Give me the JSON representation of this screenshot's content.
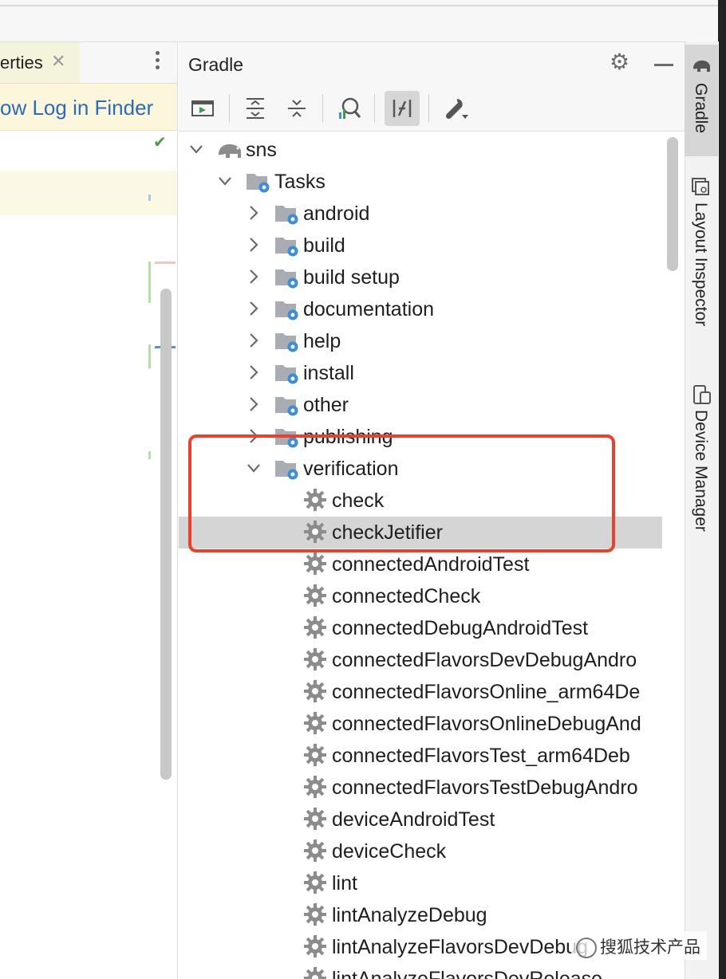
{
  "editor": {
    "tab_label": "erties",
    "close_glyph": "✕",
    "notification_link": "ow Log in Finder"
  },
  "gradle": {
    "title": "Gradle",
    "toolbar": {
      "icons": [
        "run-task-icon",
        "expand-all-icon",
        "collapse-all-icon",
        "analyze-dependencies-icon",
        "toggle-offline-icon",
        "build-settings-icon"
      ]
    },
    "tree": {
      "root": "sns",
      "tasks_label": "Tasks",
      "groups": [
        "android",
        "build",
        "build setup",
        "documentation",
        "help",
        "install",
        "other",
        "publishing"
      ],
      "expanded_group": "verification",
      "verification_tasks": [
        "check",
        "checkJetifier",
        "connectedAndroidTest",
        "connectedCheck",
        "connectedDebugAndroidTest",
        "connectedFlavorsDevDebugAndro",
        "connectedFlavorsOnline_arm64De",
        "connectedFlavorsOnlineDebugAnd",
        "connectedFlavorsTest_arm64Deb",
        "connectedFlavorsTestDebugAndro",
        "deviceAndroidTest",
        "deviceCheck",
        "lint",
        "lintAnalyzeDebug",
        "lintAnalyzeFlavorsDevDebug",
        "lintAnalyzeFlavorsDevRelease"
      ],
      "selected_task": "checkJetifier"
    }
  },
  "right_tools": {
    "gradle_label": "Gradle",
    "layout_inspector_label": "Layout Inspector",
    "device_manager_label": "Device Manager"
  },
  "watermark": "搜狐技术产品",
  "colors": {
    "highlight_border": "#e5432f",
    "link": "#2e6bb5",
    "selection": "#d5d5d5",
    "gear_blue": "#3a8fd8"
  }
}
